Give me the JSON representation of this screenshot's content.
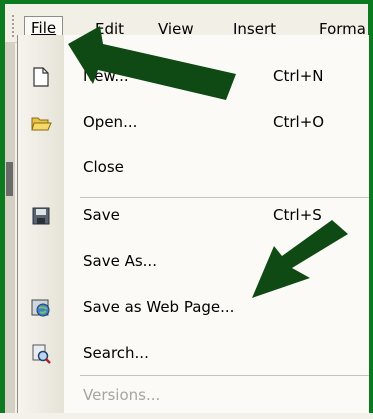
{
  "menubar": {
    "file": "File",
    "edit": "Edit",
    "view": "View",
    "insert": "Insert",
    "format": "Forma"
  },
  "file_menu": {
    "items": [
      {
        "label": "New...",
        "shortcut": "Ctrl+N",
        "icon": "new-document-icon"
      },
      {
        "label": "Open...",
        "shortcut": "Ctrl+O",
        "icon": "open-folder-icon"
      },
      {
        "label": "Close",
        "shortcut": "",
        "icon": ""
      },
      {
        "label": "Save",
        "shortcut": "Ctrl+S",
        "icon": "save-disk-icon"
      },
      {
        "label": "Save As...",
        "shortcut": "",
        "icon": ""
      },
      {
        "label": "Save as Web Page...",
        "shortcut": "",
        "icon": "web-page-icon"
      },
      {
        "label": "Search...",
        "shortcut": "",
        "icon": "search-icon"
      },
      {
        "label": "Versions...",
        "shortcut": "",
        "icon": "",
        "disabled": true
      }
    ]
  },
  "colors": {
    "frame": "#0c7a1e",
    "arrow": "#0f4a14",
    "menu_bg": "#fbfaf6",
    "disabled_text": "#a7a59e"
  }
}
